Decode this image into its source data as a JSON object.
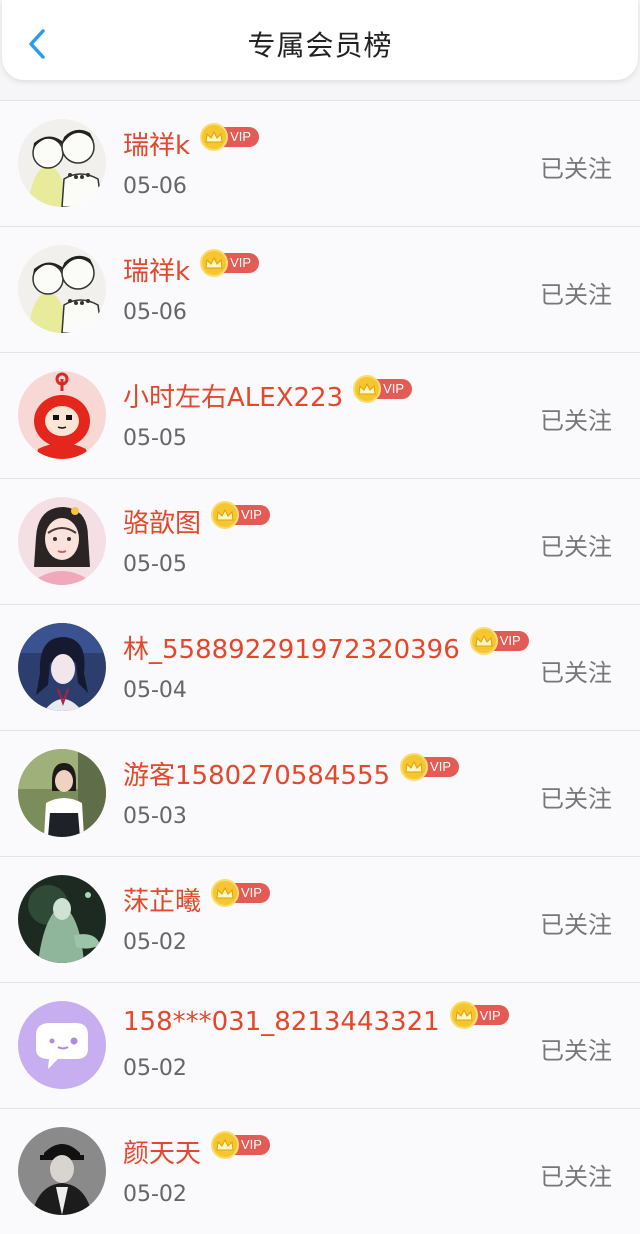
{
  "header": {
    "title": "专属会员榜"
  },
  "vip_label": "VIP",
  "colors": {
    "name": "#e4472a",
    "vip_tag": "#e45a55",
    "crown": "#f6c631",
    "back": "#2a9cf0"
  },
  "members": [
    {
      "name": "瑞祥k",
      "date": "05-06",
      "status": "已关注",
      "avatar": "anime-boys-avatar"
    },
    {
      "name": "瑞祥k",
      "date": "05-06",
      "status": "已关注",
      "avatar": "anime-boys-avatar"
    },
    {
      "name": "小时左右ALEX223",
      "date": "05-05",
      "status": "已关注",
      "avatar": "red-doll-avatar"
    },
    {
      "name": "骆歆图",
      "date": "05-05",
      "status": "已关注",
      "avatar": "girl-selfie-avatar"
    },
    {
      "name": "林_558892291972320396",
      "date": "05-04",
      "status": "已关注",
      "avatar": "anime-man-avatar"
    },
    {
      "name": "游客1580270584555",
      "date": "05-03",
      "status": "已关注",
      "avatar": "woman-photo-avatar"
    },
    {
      "name": "莯芷曦",
      "date": "05-02",
      "status": "已关注",
      "avatar": "dark-art-avatar"
    },
    {
      "name": "158***031_8213443321",
      "date": "05-02",
      "status": "已关注",
      "avatar": "chat-bubble-avatar"
    },
    {
      "name": "颜天天",
      "date": "05-02",
      "status": "已关注",
      "avatar": "sketch-man-avatar"
    }
  ]
}
